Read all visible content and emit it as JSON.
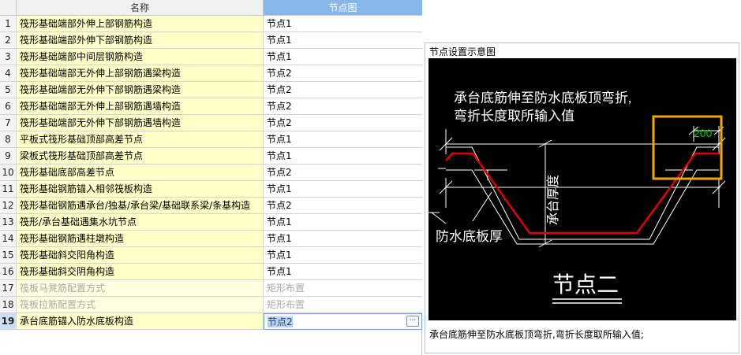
{
  "grid": {
    "headers": {
      "name": "名称",
      "node": "节点图"
    },
    "rows": [
      {
        "num": "1",
        "name": "筏形基础端部外伸上部钢筋构造",
        "node": "节点1"
      },
      {
        "num": "2",
        "name": "筏形基础端部外伸下部钢筋构造",
        "node": "节点1"
      },
      {
        "num": "3",
        "name": "筏形基础端部中间层钢筋构造",
        "node": "节点1"
      },
      {
        "num": "4",
        "name": "筏形基础端部无外伸上部钢筋遇梁构造",
        "node": "节点2"
      },
      {
        "num": "5",
        "name": "筏形基础端部无外伸下部钢筋遇梁构造",
        "node": "节点2"
      },
      {
        "num": "6",
        "name": "筏形基础端部无外伸上部钢筋遇墙构造",
        "node": "节点2"
      },
      {
        "num": "7",
        "name": "筏形基础端部无外伸下部钢筋遇墙构造",
        "node": "节点2"
      },
      {
        "num": "8",
        "name": "平板式筏形基础顶部高差节点",
        "node": "节点1"
      },
      {
        "num": "9",
        "name": "梁板式筏形基础顶部高差节点",
        "node": "节点1"
      },
      {
        "num": "10",
        "name": "筏形基础底部高差节点",
        "node": "节点2"
      },
      {
        "num": "11",
        "name": "筏形基础钢筋锚入相邻筏板构造",
        "node": "节点1"
      },
      {
        "num": "12",
        "name": "筏形基础钢筋遇承台/独基/承台梁/基础联系梁/条基构造",
        "node": "节点2"
      },
      {
        "num": "13",
        "name": "筏形/承台基础遇集水坑节点",
        "node": "节点1"
      },
      {
        "num": "14",
        "name": "筏形基础钢筋遇柱墩构造",
        "node": "节点1"
      },
      {
        "num": "15",
        "name": "筏形基础斜交阳角构造",
        "node": "节点1"
      },
      {
        "num": "16",
        "name": "筏形基础斜交阴角构造",
        "node": "节点1"
      },
      {
        "num": "17",
        "name": "筏板马凳筋配置方式",
        "node": "矩形布置"
      },
      {
        "num": "18",
        "name": "筏板拉筋配置方式",
        "node": "矩形布置"
      },
      {
        "num": "19",
        "name": "承台底筋锚入防水底板构造",
        "node": "节点2"
      }
    ]
  },
  "panel": {
    "title": "节点设置示意图",
    "diagram": {
      "text_line1": "承台底筋伸至防水底板顶弯折,",
      "text_line2": "弯折长度取所输入值",
      "dimension_value": "200",
      "label_left": "防水底板厚",
      "label_vertical": "承台厚度",
      "caption": "节点二"
    },
    "description": "承台底筋伸至防水底板顶弯折,弯折长度取所输入值;"
  },
  "colors": {
    "header_accent": "#89b6ea",
    "name_cell_bg": "#ffffc8",
    "rebar_red": "#e00000",
    "highlight_box": "#f0a800",
    "dimension_green": "#00d000",
    "diagram_bg": "#000000"
  }
}
